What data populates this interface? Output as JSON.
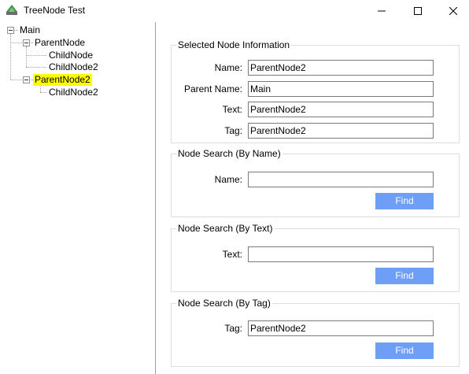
{
  "window": {
    "title": "TreeNode Test",
    "icon": "app-tree-icon",
    "controls": {
      "minimize": "minimize-icon",
      "maximize": "maximize-icon",
      "close": "close-icon"
    }
  },
  "tree": {
    "root": "Main",
    "parent1": "ParentNode",
    "parent1_child1": "ChildNode",
    "parent1_child2": "ChildNode2",
    "parent2": "ParentNode2",
    "parent2_child1": "ChildNode2",
    "selected": "ParentNode2",
    "selected_highlight": "#ffff00"
  },
  "selected_info": {
    "title": "Selected Node Information",
    "name_label": "Name:",
    "name_value": "ParentNode2",
    "parent_label": "Parent Name:",
    "parent_value": "Main",
    "text_label": "Text:",
    "text_value": "ParentNode2",
    "tag_label": "Tag:",
    "tag_value": "ParentNode2"
  },
  "search_name": {
    "title": "Node Search (By Name)",
    "label": "Name:",
    "value": "",
    "button": "Find"
  },
  "search_text": {
    "title": "Node Search (By Text)",
    "label": "Text:",
    "value": "",
    "button": "Find"
  },
  "search_tag": {
    "title": "Node Search (By Tag)",
    "label": "Tag:",
    "value": "ParentNode2",
    "button": "Find"
  },
  "colors": {
    "find_button": "#6f9ef6",
    "selection": "#ffff00"
  }
}
